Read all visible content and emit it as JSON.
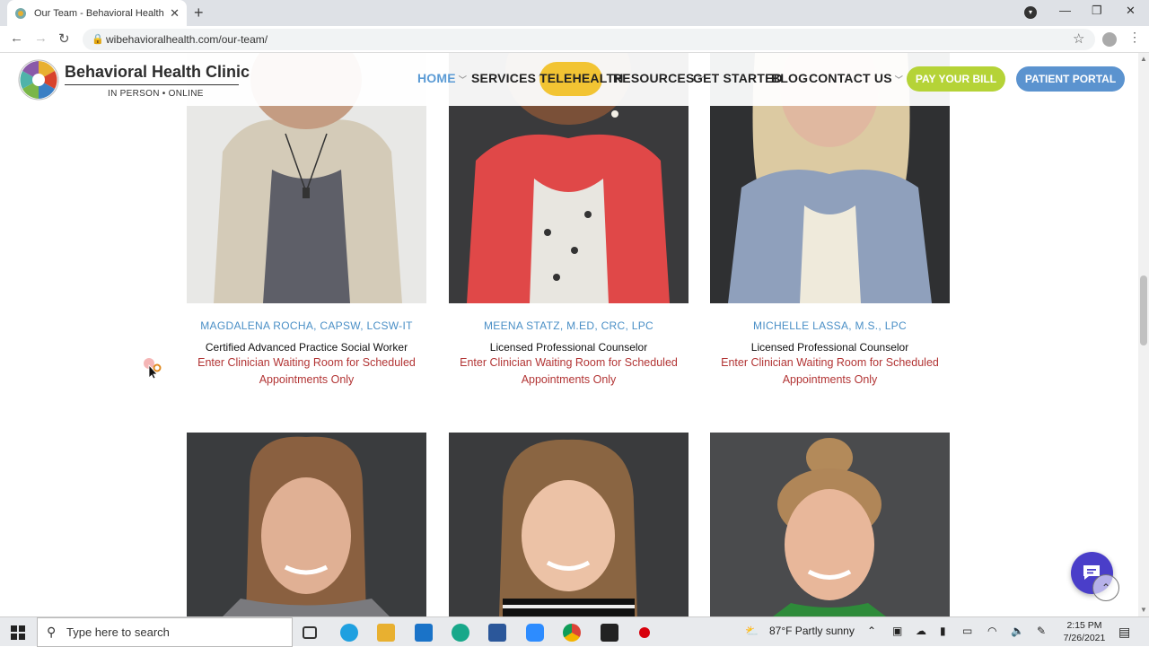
{
  "browser": {
    "tab_title": "Our Team - Behavioral Health Cli",
    "url": "wibehavioralhealth.com/our-team/",
    "new_tab": "+",
    "tab_close": "✕"
  },
  "site": {
    "logo_name": "Behavioral Health Clinic",
    "logo_tagline": "IN PERSON • ONLINE",
    "nav": {
      "home": "HOME",
      "services": "SERVICES",
      "telehealth": "TELEHEALTH",
      "resources": "RESOURCES",
      "get_started": "GET STARTED",
      "blog": "BLOG",
      "contact": "CONTACT US"
    },
    "pay_bill": "PAY YOUR BILL",
    "patient_portal": "PATIENT PORTAL"
  },
  "team": [
    {
      "name": "MAGDALENA ROCHA, CAPSW, LCSW-IT",
      "role": "Certified Advanced Practice Social Worker",
      "link": "Enter Clinician Waiting Room for Scheduled Appointments Only"
    },
    {
      "name": "MEENA STATZ, M.ED, CRC, LPC",
      "role": "Licensed Professional Counselor",
      "link": "Enter Clinician Waiting Room for Scheduled Appointments Only"
    },
    {
      "name": "MICHELLE LASSA, M.S., LPC",
      "role": "Licensed Professional Counselor",
      "link": "Enter Clinician Waiting Room for Scheduled Appointments Only"
    }
  ],
  "taskbar": {
    "search_placeholder": "Type here to search",
    "weather": "87°F  Partly sunny",
    "time": "2:15 PM",
    "date": "7/26/2021"
  },
  "colors": {
    "accent_blue": "#5b9bd5",
    "telehealth_yellow": "#f2c433",
    "pay_green": "#b5d337",
    "portal_blue": "#5b93cf",
    "link_red": "#b23434",
    "chat_purple": "#4a3ec9"
  }
}
